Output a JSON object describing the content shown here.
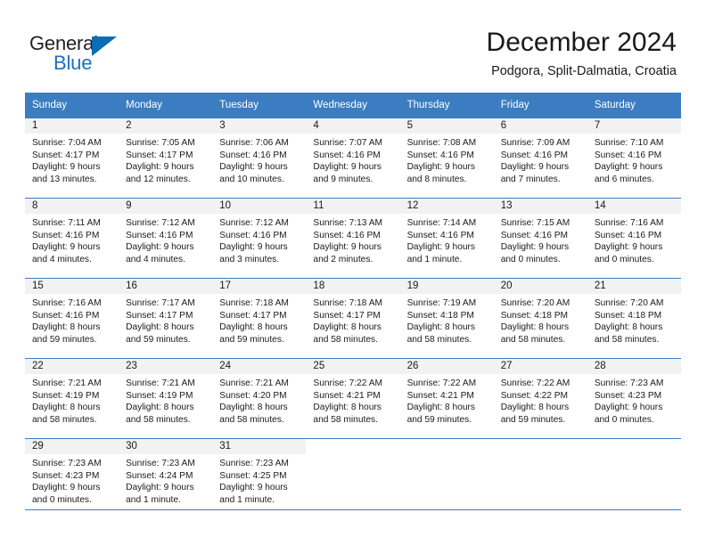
{
  "brand": {
    "name_part1": "General",
    "name_part2": "Blue",
    "flag_icon": "blue-flag-icon"
  },
  "header": {
    "title": "December 2024",
    "location": "Podgora, Split-Dalmatia, Croatia"
  },
  "colors": {
    "header_row": "#3b7dc0",
    "daynum_band": "#f2f2f2",
    "brand_blue": "#1d70b8",
    "text": "#1a1a1a"
  },
  "weekdays": [
    "Sunday",
    "Monday",
    "Tuesday",
    "Wednesday",
    "Thursday",
    "Friday",
    "Saturday"
  ],
  "weeks": [
    [
      {
        "day": "1",
        "sunrise": "Sunrise: 7:04 AM",
        "sunset": "Sunset: 4:17 PM",
        "daylight1": "Daylight: 9 hours",
        "daylight2": "and 13 minutes."
      },
      {
        "day": "2",
        "sunrise": "Sunrise: 7:05 AM",
        "sunset": "Sunset: 4:17 PM",
        "daylight1": "Daylight: 9 hours",
        "daylight2": "and 12 minutes."
      },
      {
        "day": "3",
        "sunrise": "Sunrise: 7:06 AM",
        "sunset": "Sunset: 4:16 PM",
        "daylight1": "Daylight: 9 hours",
        "daylight2": "and 10 minutes."
      },
      {
        "day": "4",
        "sunrise": "Sunrise: 7:07 AM",
        "sunset": "Sunset: 4:16 PM",
        "daylight1": "Daylight: 9 hours",
        "daylight2": "and 9 minutes."
      },
      {
        "day": "5",
        "sunrise": "Sunrise: 7:08 AM",
        "sunset": "Sunset: 4:16 PM",
        "daylight1": "Daylight: 9 hours",
        "daylight2": "and 8 minutes."
      },
      {
        "day": "6",
        "sunrise": "Sunrise: 7:09 AM",
        "sunset": "Sunset: 4:16 PM",
        "daylight1": "Daylight: 9 hours",
        "daylight2": "and 7 minutes."
      },
      {
        "day": "7",
        "sunrise": "Sunrise: 7:10 AM",
        "sunset": "Sunset: 4:16 PM",
        "daylight1": "Daylight: 9 hours",
        "daylight2": "and 6 minutes."
      }
    ],
    [
      {
        "day": "8",
        "sunrise": "Sunrise: 7:11 AM",
        "sunset": "Sunset: 4:16 PM",
        "daylight1": "Daylight: 9 hours",
        "daylight2": "and 4 minutes."
      },
      {
        "day": "9",
        "sunrise": "Sunrise: 7:12 AM",
        "sunset": "Sunset: 4:16 PM",
        "daylight1": "Daylight: 9 hours",
        "daylight2": "and 4 minutes."
      },
      {
        "day": "10",
        "sunrise": "Sunrise: 7:12 AM",
        "sunset": "Sunset: 4:16 PM",
        "daylight1": "Daylight: 9 hours",
        "daylight2": "and 3 minutes."
      },
      {
        "day": "11",
        "sunrise": "Sunrise: 7:13 AM",
        "sunset": "Sunset: 4:16 PM",
        "daylight1": "Daylight: 9 hours",
        "daylight2": "and 2 minutes."
      },
      {
        "day": "12",
        "sunrise": "Sunrise: 7:14 AM",
        "sunset": "Sunset: 4:16 PM",
        "daylight1": "Daylight: 9 hours",
        "daylight2": "and 1 minute."
      },
      {
        "day": "13",
        "sunrise": "Sunrise: 7:15 AM",
        "sunset": "Sunset: 4:16 PM",
        "daylight1": "Daylight: 9 hours",
        "daylight2": "and 0 minutes."
      },
      {
        "day": "14",
        "sunrise": "Sunrise: 7:16 AM",
        "sunset": "Sunset: 4:16 PM",
        "daylight1": "Daylight: 9 hours",
        "daylight2": "and 0 minutes."
      }
    ],
    [
      {
        "day": "15",
        "sunrise": "Sunrise: 7:16 AM",
        "sunset": "Sunset: 4:16 PM",
        "daylight1": "Daylight: 8 hours",
        "daylight2": "and 59 minutes."
      },
      {
        "day": "16",
        "sunrise": "Sunrise: 7:17 AM",
        "sunset": "Sunset: 4:17 PM",
        "daylight1": "Daylight: 8 hours",
        "daylight2": "and 59 minutes."
      },
      {
        "day": "17",
        "sunrise": "Sunrise: 7:18 AM",
        "sunset": "Sunset: 4:17 PM",
        "daylight1": "Daylight: 8 hours",
        "daylight2": "and 59 minutes."
      },
      {
        "day": "18",
        "sunrise": "Sunrise: 7:18 AM",
        "sunset": "Sunset: 4:17 PM",
        "daylight1": "Daylight: 8 hours",
        "daylight2": "and 58 minutes."
      },
      {
        "day": "19",
        "sunrise": "Sunrise: 7:19 AM",
        "sunset": "Sunset: 4:18 PM",
        "daylight1": "Daylight: 8 hours",
        "daylight2": "and 58 minutes."
      },
      {
        "day": "20",
        "sunrise": "Sunrise: 7:20 AM",
        "sunset": "Sunset: 4:18 PM",
        "daylight1": "Daylight: 8 hours",
        "daylight2": "and 58 minutes."
      },
      {
        "day": "21",
        "sunrise": "Sunrise: 7:20 AM",
        "sunset": "Sunset: 4:18 PM",
        "daylight1": "Daylight: 8 hours",
        "daylight2": "and 58 minutes."
      }
    ],
    [
      {
        "day": "22",
        "sunrise": "Sunrise: 7:21 AM",
        "sunset": "Sunset: 4:19 PM",
        "daylight1": "Daylight: 8 hours",
        "daylight2": "and 58 minutes."
      },
      {
        "day": "23",
        "sunrise": "Sunrise: 7:21 AM",
        "sunset": "Sunset: 4:19 PM",
        "daylight1": "Daylight: 8 hours",
        "daylight2": "and 58 minutes."
      },
      {
        "day": "24",
        "sunrise": "Sunrise: 7:21 AM",
        "sunset": "Sunset: 4:20 PM",
        "daylight1": "Daylight: 8 hours",
        "daylight2": "and 58 minutes."
      },
      {
        "day": "25",
        "sunrise": "Sunrise: 7:22 AM",
        "sunset": "Sunset: 4:21 PM",
        "daylight1": "Daylight: 8 hours",
        "daylight2": "and 58 minutes."
      },
      {
        "day": "26",
        "sunrise": "Sunrise: 7:22 AM",
        "sunset": "Sunset: 4:21 PM",
        "daylight1": "Daylight: 8 hours",
        "daylight2": "and 59 minutes."
      },
      {
        "day": "27",
        "sunrise": "Sunrise: 7:22 AM",
        "sunset": "Sunset: 4:22 PM",
        "daylight1": "Daylight: 8 hours",
        "daylight2": "and 59 minutes."
      },
      {
        "day": "28",
        "sunrise": "Sunrise: 7:23 AM",
        "sunset": "Sunset: 4:23 PM",
        "daylight1": "Daylight: 9 hours",
        "daylight2": "and 0 minutes."
      }
    ],
    [
      {
        "day": "29",
        "sunrise": "Sunrise: 7:23 AM",
        "sunset": "Sunset: 4:23 PM",
        "daylight1": "Daylight: 9 hours",
        "daylight2": "and 0 minutes."
      },
      {
        "day": "30",
        "sunrise": "Sunrise: 7:23 AM",
        "sunset": "Sunset: 4:24 PM",
        "daylight1": "Daylight: 9 hours",
        "daylight2": "and 1 minute."
      },
      {
        "day": "31",
        "sunrise": "Sunrise: 7:23 AM",
        "sunset": "Sunset: 4:25 PM",
        "daylight1": "Daylight: 9 hours",
        "daylight2": "and 1 minute."
      },
      {
        "day": "",
        "sunrise": "",
        "sunset": "",
        "daylight1": "",
        "daylight2": ""
      },
      {
        "day": "",
        "sunrise": "",
        "sunset": "",
        "daylight1": "",
        "daylight2": ""
      },
      {
        "day": "",
        "sunrise": "",
        "sunset": "",
        "daylight1": "",
        "daylight2": ""
      },
      {
        "day": "",
        "sunrise": "",
        "sunset": "",
        "daylight1": "",
        "daylight2": ""
      }
    ]
  ]
}
